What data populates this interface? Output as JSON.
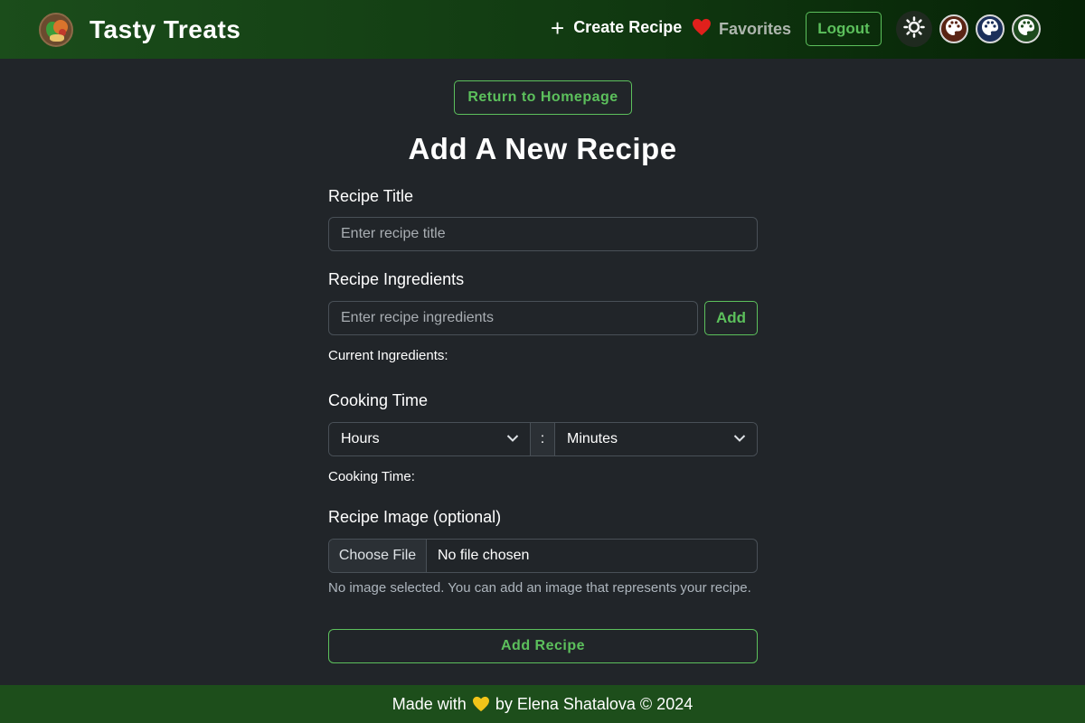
{
  "navbar": {
    "brand_title": "Tasty Treats",
    "create_label": "Create Recipe",
    "favorites_label": "Favorites",
    "logout_label": "Logout",
    "theme_icons": [
      "sun-icon",
      "palette-icon",
      "palette-icon",
      "palette-icon"
    ],
    "palette_colors": [
      "#5a2414",
      "#1b2f5a",
      "#1d4a1d"
    ]
  },
  "main": {
    "return_label": "Return to Homepage",
    "page_title": "Add A New Recipe",
    "title_field": {
      "label": "Recipe Title",
      "placeholder": "Enter recipe title"
    },
    "ingredients_field": {
      "label": "Recipe Ingredients",
      "placeholder": "Enter recipe ingredients",
      "add_label": "Add",
      "current_label": "Current Ingredients:"
    },
    "cooking_time": {
      "label": "Cooking Time",
      "hours_value": "Hours",
      "separator": ":",
      "minutes_value": "Minutes",
      "summary_label": "Cooking Time:"
    },
    "image_field": {
      "label": "Recipe Image (optional)",
      "choose_label": "Choose File",
      "status": "No file chosen",
      "help": "No image selected. You can add an image that represents your recipe."
    },
    "submit_label": "Add Recipe"
  },
  "footer": {
    "prefix": "Made with",
    "suffix": "by Elena Shatalova © 2024"
  },
  "colors": {
    "accent_green": "#5cc05c",
    "background": "#212529",
    "footer_bg": "#1d4e1b",
    "heart_red": "#e0201c",
    "heart_yellow": "#f2c419"
  }
}
